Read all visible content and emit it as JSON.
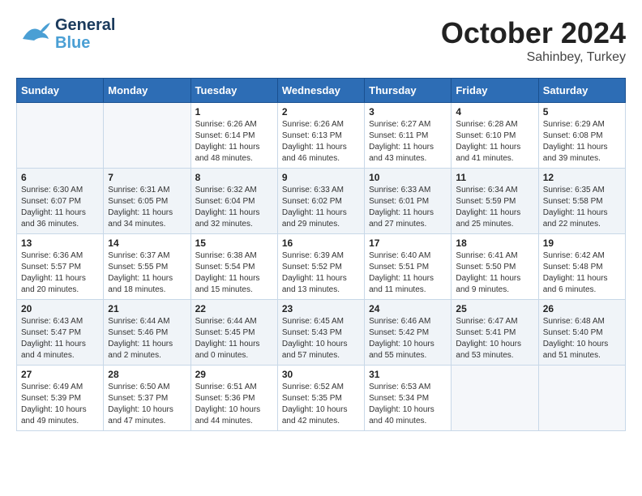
{
  "header": {
    "logo_line1": "General",
    "logo_line2": "Blue",
    "month": "October 2024",
    "location": "Sahinbey, Turkey"
  },
  "weekdays": [
    "Sunday",
    "Monday",
    "Tuesday",
    "Wednesday",
    "Thursday",
    "Friday",
    "Saturday"
  ],
  "weeks": [
    [
      {
        "day": "",
        "info": ""
      },
      {
        "day": "",
        "info": ""
      },
      {
        "day": "1",
        "info": "Sunrise: 6:26 AM\nSunset: 6:14 PM\nDaylight: 11 hours and 48 minutes."
      },
      {
        "day": "2",
        "info": "Sunrise: 6:26 AM\nSunset: 6:13 PM\nDaylight: 11 hours and 46 minutes."
      },
      {
        "day": "3",
        "info": "Sunrise: 6:27 AM\nSunset: 6:11 PM\nDaylight: 11 hours and 43 minutes."
      },
      {
        "day": "4",
        "info": "Sunrise: 6:28 AM\nSunset: 6:10 PM\nDaylight: 11 hours and 41 minutes."
      },
      {
        "day": "5",
        "info": "Sunrise: 6:29 AM\nSunset: 6:08 PM\nDaylight: 11 hours and 39 minutes."
      }
    ],
    [
      {
        "day": "6",
        "info": "Sunrise: 6:30 AM\nSunset: 6:07 PM\nDaylight: 11 hours and 36 minutes."
      },
      {
        "day": "7",
        "info": "Sunrise: 6:31 AM\nSunset: 6:05 PM\nDaylight: 11 hours and 34 minutes."
      },
      {
        "day": "8",
        "info": "Sunrise: 6:32 AM\nSunset: 6:04 PM\nDaylight: 11 hours and 32 minutes."
      },
      {
        "day": "9",
        "info": "Sunrise: 6:33 AM\nSunset: 6:02 PM\nDaylight: 11 hours and 29 minutes."
      },
      {
        "day": "10",
        "info": "Sunrise: 6:33 AM\nSunset: 6:01 PM\nDaylight: 11 hours and 27 minutes."
      },
      {
        "day": "11",
        "info": "Sunrise: 6:34 AM\nSunset: 5:59 PM\nDaylight: 11 hours and 25 minutes."
      },
      {
        "day": "12",
        "info": "Sunrise: 6:35 AM\nSunset: 5:58 PM\nDaylight: 11 hours and 22 minutes."
      }
    ],
    [
      {
        "day": "13",
        "info": "Sunrise: 6:36 AM\nSunset: 5:57 PM\nDaylight: 11 hours and 20 minutes."
      },
      {
        "day": "14",
        "info": "Sunrise: 6:37 AM\nSunset: 5:55 PM\nDaylight: 11 hours and 18 minutes."
      },
      {
        "day": "15",
        "info": "Sunrise: 6:38 AM\nSunset: 5:54 PM\nDaylight: 11 hours and 15 minutes."
      },
      {
        "day": "16",
        "info": "Sunrise: 6:39 AM\nSunset: 5:52 PM\nDaylight: 11 hours and 13 minutes."
      },
      {
        "day": "17",
        "info": "Sunrise: 6:40 AM\nSunset: 5:51 PM\nDaylight: 11 hours and 11 minutes."
      },
      {
        "day": "18",
        "info": "Sunrise: 6:41 AM\nSunset: 5:50 PM\nDaylight: 11 hours and 9 minutes."
      },
      {
        "day": "19",
        "info": "Sunrise: 6:42 AM\nSunset: 5:48 PM\nDaylight: 11 hours and 6 minutes."
      }
    ],
    [
      {
        "day": "20",
        "info": "Sunrise: 6:43 AM\nSunset: 5:47 PM\nDaylight: 11 hours and 4 minutes."
      },
      {
        "day": "21",
        "info": "Sunrise: 6:44 AM\nSunset: 5:46 PM\nDaylight: 11 hours and 2 minutes."
      },
      {
        "day": "22",
        "info": "Sunrise: 6:44 AM\nSunset: 5:45 PM\nDaylight: 11 hours and 0 minutes."
      },
      {
        "day": "23",
        "info": "Sunrise: 6:45 AM\nSunset: 5:43 PM\nDaylight: 10 hours and 57 minutes."
      },
      {
        "day": "24",
        "info": "Sunrise: 6:46 AM\nSunset: 5:42 PM\nDaylight: 10 hours and 55 minutes."
      },
      {
        "day": "25",
        "info": "Sunrise: 6:47 AM\nSunset: 5:41 PM\nDaylight: 10 hours and 53 minutes."
      },
      {
        "day": "26",
        "info": "Sunrise: 6:48 AM\nSunset: 5:40 PM\nDaylight: 10 hours and 51 minutes."
      }
    ],
    [
      {
        "day": "27",
        "info": "Sunrise: 6:49 AM\nSunset: 5:39 PM\nDaylight: 10 hours and 49 minutes."
      },
      {
        "day": "28",
        "info": "Sunrise: 6:50 AM\nSunset: 5:37 PM\nDaylight: 10 hours and 47 minutes."
      },
      {
        "day": "29",
        "info": "Sunrise: 6:51 AM\nSunset: 5:36 PM\nDaylight: 10 hours and 44 minutes."
      },
      {
        "day": "30",
        "info": "Sunrise: 6:52 AM\nSunset: 5:35 PM\nDaylight: 10 hours and 42 minutes."
      },
      {
        "day": "31",
        "info": "Sunrise: 6:53 AM\nSunset: 5:34 PM\nDaylight: 10 hours and 40 minutes."
      },
      {
        "day": "",
        "info": ""
      },
      {
        "day": "",
        "info": ""
      }
    ]
  ]
}
